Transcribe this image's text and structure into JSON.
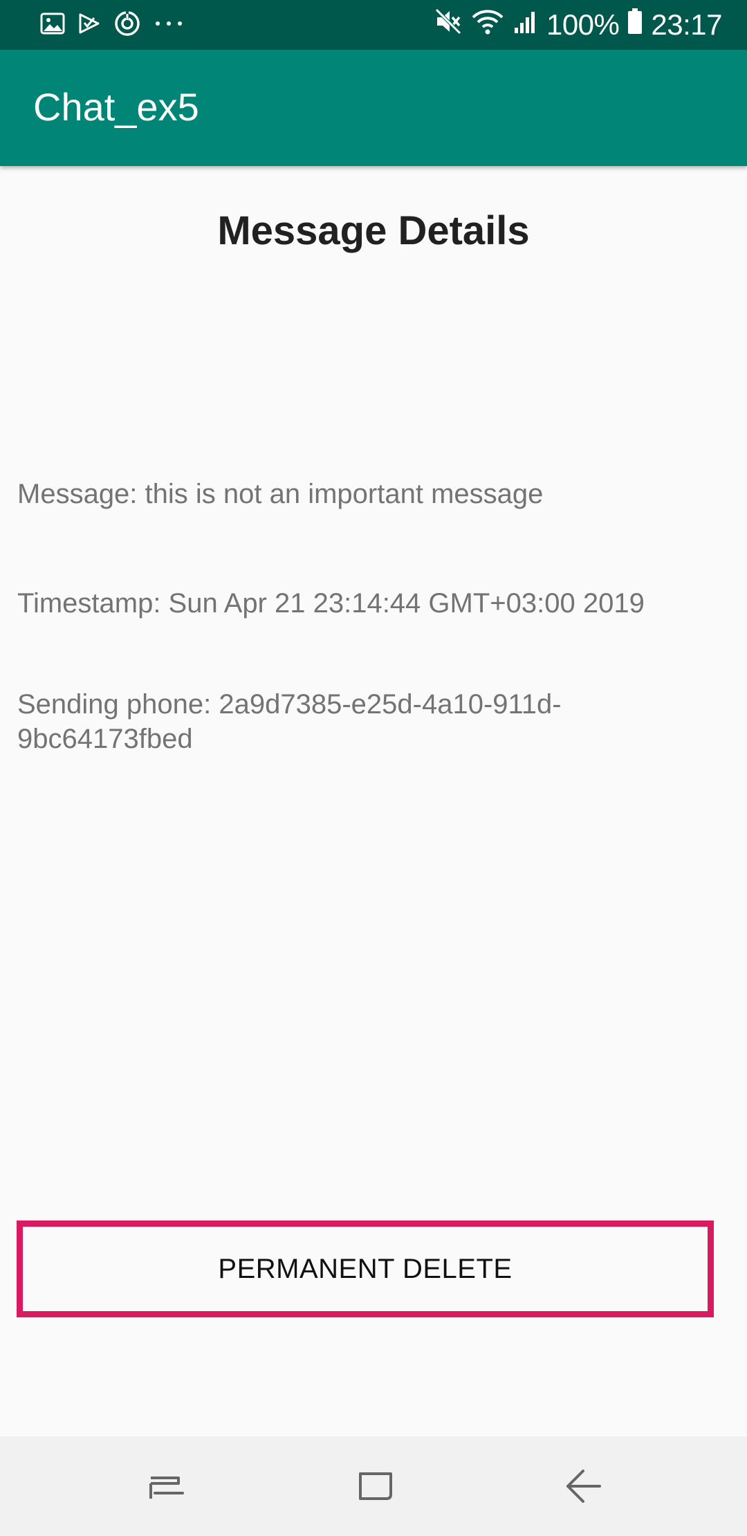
{
  "status_bar": {
    "icons_left": [
      "image-icon",
      "play-store-icon",
      "sync-icon",
      "more-dots-icon"
    ],
    "icons_right": [
      "mute-icon",
      "wifi-icon",
      "signal-icon"
    ],
    "battery_percent": "100%",
    "time": "23:17"
  },
  "app_bar": {
    "title": "Chat_ex5"
  },
  "page": {
    "title": "Message Details",
    "message": "Message: this is not an important message",
    "timestamp": "Timestamp: Sun Apr 21 23:14:44 GMT+03:00 2019",
    "sending_phone": "Sending phone: 2a9d7385-e25d-4a10-911d-9bc64173fbed",
    "delete_button_label": "PERMANENT DELETE"
  },
  "colors": {
    "status_bar": "#00574b",
    "app_bar": "#008577",
    "button_border": "#d81b60",
    "background": "#fafafa"
  },
  "nav_bar": {
    "buttons": [
      "recent-apps-icon",
      "home-icon",
      "back-icon"
    ]
  }
}
